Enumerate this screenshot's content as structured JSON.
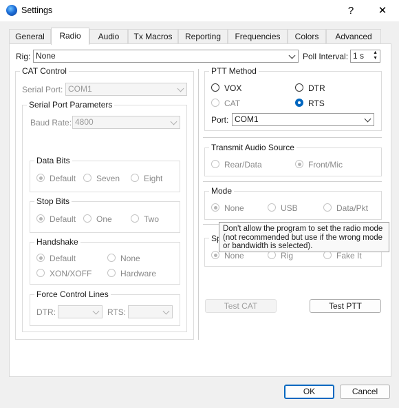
{
  "window": {
    "title": "Settings",
    "help_glyph": "?",
    "close_glyph": "✕"
  },
  "tabs": [
    {
      "label": "General"
    },
    {
      "label": "Radio"
    },
    {
      "label": "Audio"
    },
    {
      "label": "Tx Macros"
    },
    {
      "label": "Reporting"
    },
    {
      "label": "Frequencies"
    },
    {
      "label": "Colors"
    },
    {
      "label": "Advanced"
    }
  ],
  "active_tab": "Radio",
  "rig": {
    "label": "Rig:",
    "value": "None"
  },
  "poll": {
    "label": "Poll Interval:",
    "value": "1 s"
  },
  "cat_control": {
    "title": "CAT Control",
    "serial_port_label": "Serial Port:",
    "serial_port_value": "COM1",
    "spp_title": "Serial Port Parameters",
    "baud_label": "Baud Rate:",
    "baud_value": "4800",
    "data_bits": {
      "title": "Data Bits",
      "options": [
        "Default",
        "Seven",
        "Eight"
      ]
    },
    "stop_bits": {
      "title": "Stop Bits",
      "options": [
        "Default",
        "One",
        "Two"
      ]
    },
    "handshake": {
      "title": "Handshake",
      "options": [
        "Default",
        "None",
        "XON/XOFF",
        "Hardware"
      ]
    },
    "force": {
      "title": "Force Control Lines",
      "dtr_label": "DTR:",
      "rts_label": "RTS:"
    }
  },
  "ptt": {
    "title": "PTT Method",
    "options": [
      "VOX",
      "DTR",
      "CAT",
      "RTS"
    ],
    "selected": "RTS",
    "port_label": "Port:",
    "port_value": "COM1"
  },
  "audio_source": {
    "title": "Transmit Audio Source",
    "options": [
      "Rear/Data",
      "Front/Mic"
    ],
    "selected": "Front/Mic"
  },
  "mode": {
    "title": "Mode",
    "options": [
      "None",
      "USB",
      "Data/Pkt"
    ],
    "selected": "None"
  },
  "split": {
    "title": "Sp",
    "options": [
      "None",
      "Rig",
      "Fake It"
    ],
    "selected": "None"
  },
  "tooltip": {
    "line1": "Don't allow the program to set the radio mode",
    "line2": "(not recommended but use if the wrong mode",
    "line3": "or bandwidth is selected)."
  },
  "buttons": {
    "test_cat": "Test CAT",
    "test_ptt": "Test PTT",
    "ok": "OK",
    "cancel": "Cancel"
  }
}
